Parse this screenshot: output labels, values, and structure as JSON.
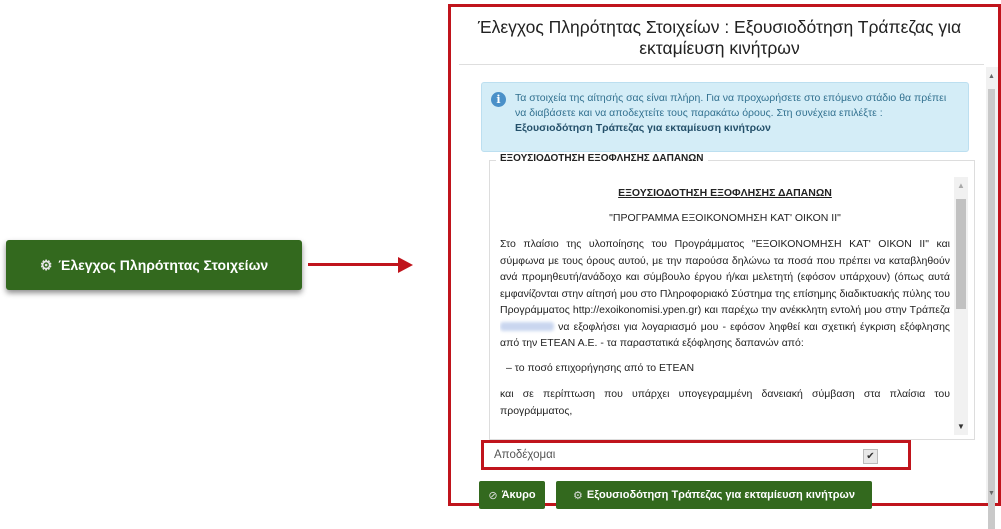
{
  "left_button": {
    "icon": "gear-icon",
    "label": "Έλεγχος Πληρότητας Στοιχείων"
  },
  "dialog": {
    "title": "Έλεγχος Πληρότητας Στοιχείων : Εξουσιοδότηση Τράπεζας για εκταμίευση κινήτρων",
    "info": {
      "icon": "info-icon",
      "text": "Τα στοιχεία της αίτησής σας είναι πλήρη. Για να προχωρήσετε στο επόμενο στάδιο θα πρέπει να διαβάσετε και να αποδεχτείτε τους παρακάτω όρους. Στη συνέχεια επιλέξτε : ",
      "bold": "Εξουσιοδότηση Τράπεζας για εκταμίευση κινήτρων"
    },
    "legend": "ΕΞΟΥΣΙΟΔΟΤΗΣΗ ΕΞΟΦΛΗΣΗΣ ΔΑΠΑΝΩΝ",
    "document": {
      "heading": "ΕΞΟΥΣΙΟΔΟΤΗΣΗ ΕΞΟΦΛΗΣΗΣ ΔΑΠΑΝΩΝ",
      "subheading": "\"ΠΡΟΓΡΑΜΜΑ ΕΞΟΙΚΟΝΟΜΗΣΗ ΚΑΤ' ΟΙΚΟΝ ΙΙ\"",
      "paragraph_a": "Στο πλαίσιο της υλοποίησης του Προγράμματος \"ΕΞΟΙΚΟΝΟΜΗΣΗ ΚΑΤ' ΟΙΚΟΝ ΙΙ\" και σύμφωνα με τους όρους αυτού, με την παρούσα δηλώνω τα ποσά που πρέπει να καταβληθούν ανά προμηθευτή/ανάδοχο και σύμβουλο έργου ή/και μελετητή (εφόσον υπάρχουν) (όπως αυτά εμφανίζονται στην αίτησή μου στο Πληροφοριακό Σύστημα της επίσημης διαδικτυακής πύλης του Προγράμματος http://exoikonomisi.ypen.gr) και παρέχω την ανέκκλητη εντολή μου στην Τράπεζα",
      "paragraph_b": "να εξοφλήσει για λογαριασμό μου - εφόσον ληφθεί και σχετική έγκριση εξόφλησης από την ΕΤΕΑΝ Α.Ε. - τα παραστατικά εξόφλησης δαπανών από:",
      "list_item": "–  το ποσό επιχορήγησης από το ΕΤΕΑΝ",
      "paragraph_c": "και σε περίπτωση που υπάρχει υπογεγραμμένη δανειακή σύμβαση στα πλαίσια του προγράμματος,"
    },
    "accept": {
      "label": "Αποδέχομαι",
      "checked": true,
      "check_mark": "✔"
    },
    "buttons": {
      "cancel": {
        "icon": "ban-icon",
        "label": "Άκυρο"
      },
      "authorize": {
        "icon": "gear-icon",
        "label": "Εξουσιοδότηση Τράπεζας για εκταμίευση κινήτρων"
      }
    }
  },
  "colors": {
    "accent_red": "#c0141c",
    "button_green": "#33691e",
    "info_bg": "#d4edf7",
    "info_text": "#31708f"
  }
}
